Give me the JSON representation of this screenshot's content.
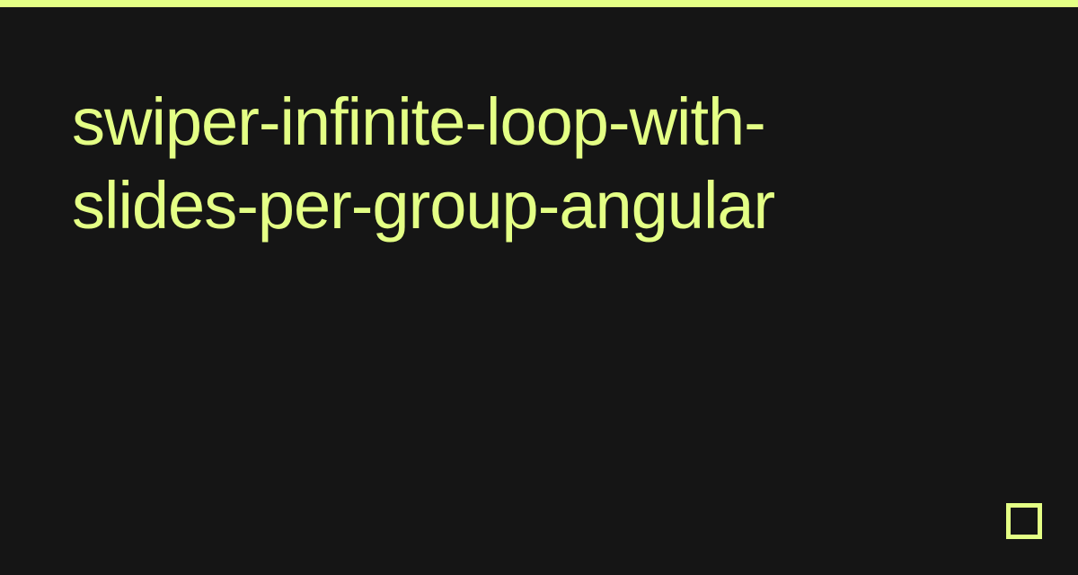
{
  "title": "swiper-infinite-loop-with-slides-per-group-angular",
  "colors": {
    "accent": "#e4ff85",
    "background": "#151515"
  }
}
